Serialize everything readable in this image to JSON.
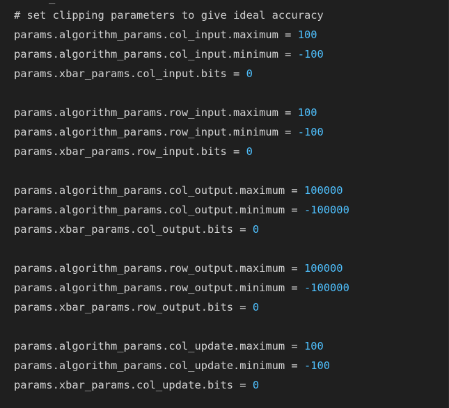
{
  "editor": {
    "top_fragment": "_",
    "lines": [
      {
        "text": "# set clipping parameters to give ideal accuracy",
        "value": ""
      },
      {
        "text": "params.algorithm_params.col_input.maximum = ",
        "value": "100"
      },
      {
        "text": "params.algorithm_params.col_input.minimum = ",
        "value": "-100"
      },
      {
        "text": "params.xbar_params.col_input.bits = ",
        "value": "0"
      },
      {
        "text": "",
        "value": ""
      },
      {
        "text": "params.algorithm_params.row_input.maximum = ",
        "value": "100"
      },
      {
        "text": "params.algorithm_params.row_input.minimum = ",
        "value": "-100"
      },
      {
        "text": "params.xbar_params.row_input.bits = ",
        "value": "0"
      },
      {
        "text": "",
        "value": ""
      },
      {
        "text": "params.algorithm_params.col_output.maximum = ",
        "value": "100000"
      },
      {
        "text": "params.algorithm_params.col_output.minimum = ",
        "value": "-100000"
      },
      {
        "text": "params.xbar_params.col_output.bits = ",
        "value": "0"
      },
      {
        "text": "",
        "value": ""
      },
      {
        "text": "params.algorithm_params.row_output.maximum = ",
        "value": "100000"
      },
      {
        "text": "params.algorithm_params.row_output.minimum = ",
        "value": "-100000"
      },
      {
        "text": "params.xbar_params.row_output.bits = ",
        "value": "0"
      },
      {
        "text": "",
        "value": ""
      },
      {
        "text": "params.algorithm_params.col_update.maximum = ",
        "value": "100"
      },
      {
        "text": "params.algorithm_params.col_update.minimum = ",
        "value": "-100"
      },
      {
        "text": "params.xbar_params.col_update.bits = ",
        "value": "0"
      }
    ]
  },
  "colors": {
    "background": "#1f1f1f",
    "text": "#d4d4d4",
    "number": "#4fc1ff",
    "comment": "#cfcfcf"
  }
}
